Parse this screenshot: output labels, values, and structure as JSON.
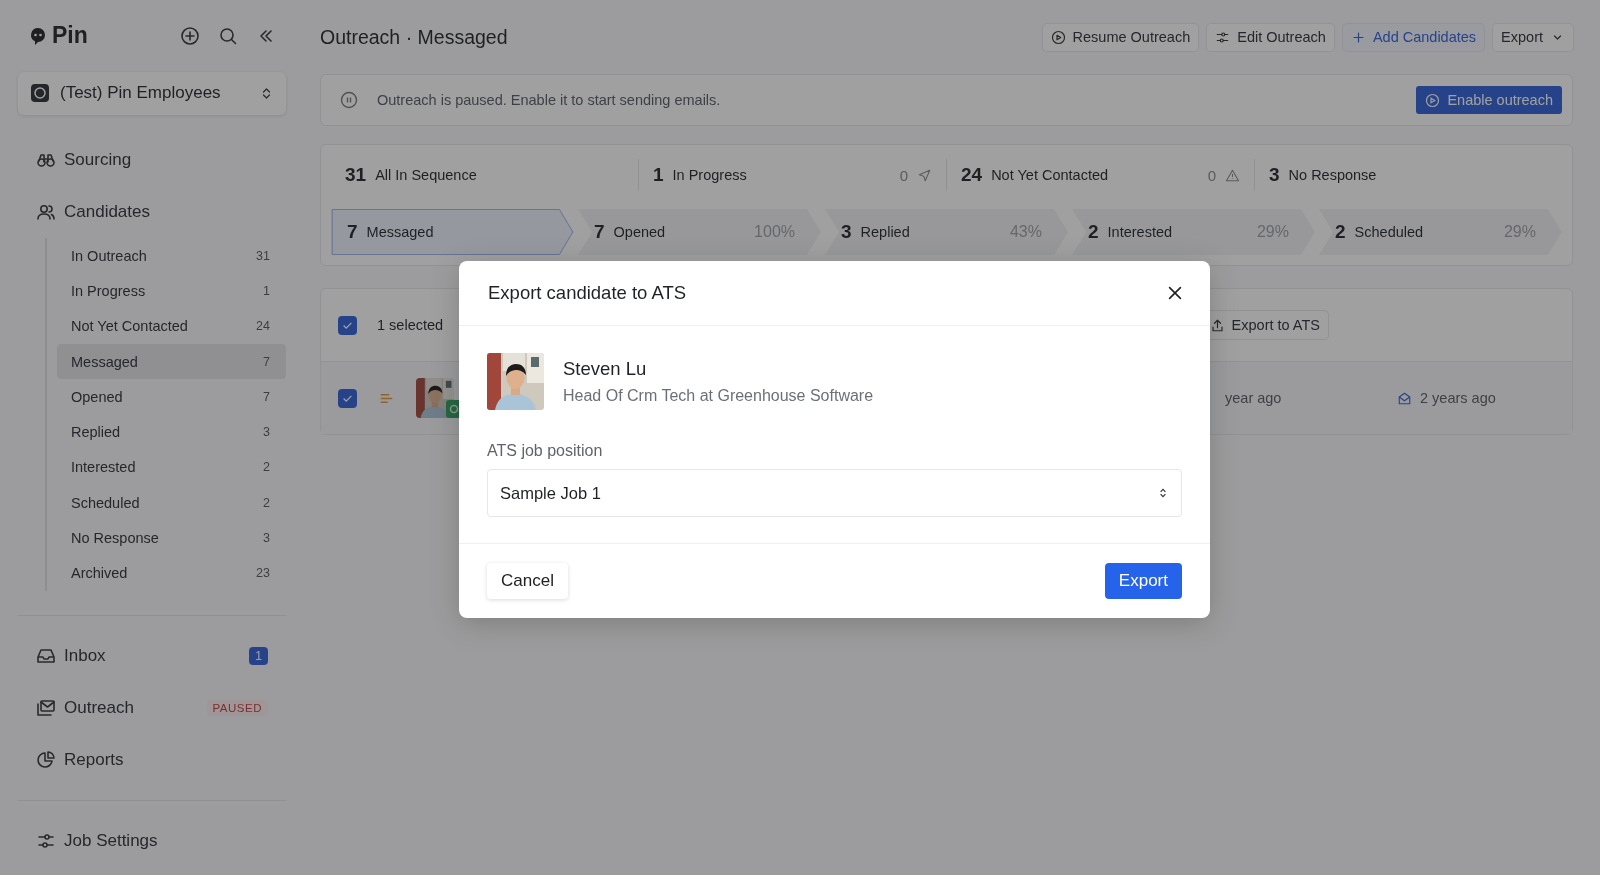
{
  "app": {
    "name": "Pin"
  },
  "workspace": {
    "name": "(Test) Pin Employees"
  },
  "sidebar": {
    "sections": [
      [
        {
          "label": "Sourcing"
        },
        {
          "label": "Candidates",
          "children": [
            {
              "label": "In Outreach",
              "count": "31",
              "selected": false
            },
            {
              "label": "In Progress",
              "count": "1",
              "selected": false
            },
            {
              "label": "Not Yet Contacted",
              "count": "24",
              "selected": false
            },
            {
              "label": "Messaged",
              "count": "7",
              "selected": true
            },
            {
              "label": "Opened",
              "count": "7",
              "selected": false
            },
            {
              "label": "Replied",
              "count": "3",
              "selected": false
            },
            {
              "label": "Interested",
              "count": "2",
              "selected": false
            },
            {
              "label": "Scheduled",
              "count": "2",
              "selected": false
            },
            {
              "label": "No Response",
              "count": "3",
              "selected": false
            },
            {
              "label": "Archived",
              "count": "23",
              "selected": false
            }
          ]
        }
      ],
      [
        {
          "label": "Inbox",
          "badge": "1"
        },
        {
          "label": "Outreach",
          "tag": "PAUSED"
        },
        {
          "label": "Reports"
        }
      ],
      [
        {
          "label": "Job Settings"
        }
      ]
    ]
  },
  "header": {
    "title": "Outreach · Messaged",
    "actions": [
      {
        "label": "Resume Outreach",
        "kind": "play"
      },
      {
        "label": "Edit Outreach",
        "kind": "edit"
      },
      {
        "label": "Add Candidates",
        "kind": "add"
      },
      {
        "label": "Export",
        "kind": "menu"
      }
    ]
  },
  "banner": {
    "text": "Outreach is paused. Enable it to start sending emails.",
    "button": "Enable outreach"
  },
  "stats": [
    {
      "value": "31",
      "label": "All In Sequence"
    },
    {
      "value": "1",
      "label": "In Progress",
      "extra": "0",
      "kind": "sent"
    },
    {
      "value": "24",
      "label": "Not Yet Contacted",
      "extra": "0",
      "kind": "warning"
    },
    {
      "value": "3",
      "label": "No Response"
    }
  ],
  "funnel": [
    {
      "value": "7",
      "label": "Messaged",
      "selected": true
    },
    {
      "value": "7",
      "label": "Opened",
      "percent": "100%",
      "selected": false
    },
    {
      "value": "3",
      "label": "Replied",
      "percent": "43%",
      "selected": false
    },
    {
      "value": "2",
      "label": "Interested",
      "percent": "29%",
      "selected": false
    },
    {
      "value": "2",
      "label": "Scheduled",
      "percent": "29%",
      "selected": false
    }
  ],
  "table": {
    "select_all": {
      "checked": true
    },
    "selected_label": "1 selected",
    "toolbar_button": "Export to ATS",
    "rows": [
      {
        "checked": true,
        "column_1": "year ago",
        "column_2": "2 years ago"
      }
    ]
  },
  "modal": {
    "title": "Export candidate to ATS",
    "candidate": {
      "name": "Steven Lu",
      "headline": "Head Of Crm Tech at Greenhouse Software"
    },
    "field": {
      "label": "ATS job position",
      "value": "Sample Job 1"
    },
    "buttons": [
      {
        "label": "Cancel",
        "kind": "secondary"
      },
      {
        "label": "Export",
        "kind": "primary"
      }
    ]
  }
}
